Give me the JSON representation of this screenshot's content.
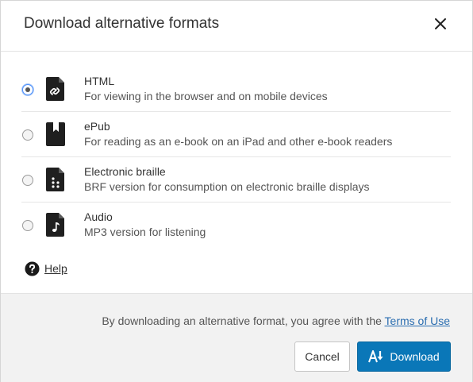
{
  "dialog": {
    "title": "Download alternative formats",
    "close_icon": "close-icon"
  },
  "options": [
    {
      "name": "HTML",
      "description": "For viewing in the browser and on mobile devices",
      "icon": "html-file-link-icon",
      "selected": true
    },
    {
      "name": "ePub",
      "description": "For reading as an e-book on an iPad and other e-book readers",
      "icon": "epub-bookmark-icon",
      "selected": false
    },
    {
      "name": "Electronic braille",
      "description": "BRF version for consumption on electronic braille displays",
      "icon": "braille-file-icon",
      "selected": false
    },
    {
      "name": "Audio",
      "description": "MP3 version for listening",
      "icon": "audio-file-icon",
      "selected": false
    }
  ],
  "help": {
    "label": "Help",
    "icon": "question-circle-icon"
  },
  "footer": {
    "terms_prefix": "By downloading an alternative format, you agree with the",
    "terms_link": "Terms of Use",
    "cancel_label": "Cancel",
    "download_label": "Download",
    "download_icon": "download-arrow-icon"
  },
  "colors": {
    "primary": "#0a77b8",
    "link": "#2a6db0",
    "footer_bg": "#f2f2f2"
  }
}
